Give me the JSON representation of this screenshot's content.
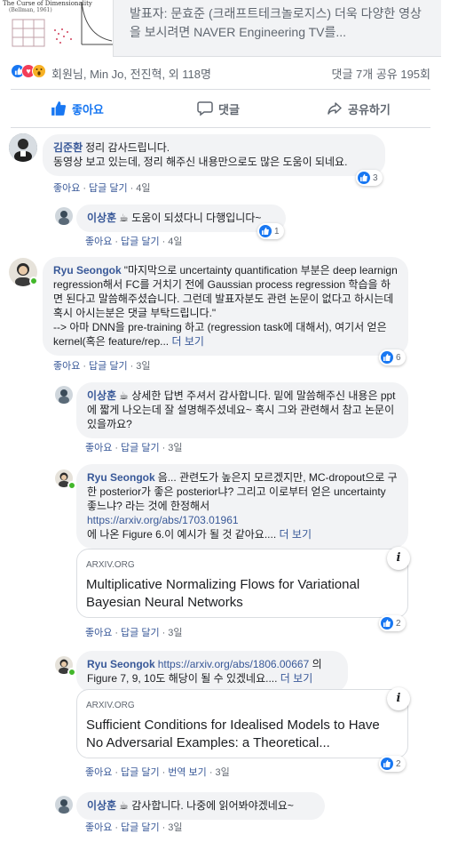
{
  "preview": {
    "thumb_title": "The Curse of Dimensionality",
    "thumb_subtitle": "(Bellman, 1961)",
    "description": "발표자: 문효준 (크래프트테크놀로지스) 더욱 다양한 영상을 보시려면 NAVER Engineering TV를..."
  },
  "summary": {
    "names": "회원님, Min Jo, 전진혁, 외 118명",
    "counts": "댓글 7개  공유 195회"
  },
  "actions": {
    "like": "좋아요",
    "comment": "댓글",
    "share": "공유하기"
  },
  "labels": {
    "like": "좋아요",
    "reply": "답글 달기",
    "translate": "번역 보기",
    "see_more": "더 보기",
    "info": "i"
  },
  "comments": [
    {
      "author": "김준환",
      "text": "정리 감사드립니다.\n동영상 보고 있는데, 정리 해주신 내용만으로도 많은 도움이 되네요.",
      "time": "4일",
      "likes": "3"
    },
    {
      "author": "이상훈",
      "text": "도움이 되셨다니 다행입니다~",
      "time": "4일",
      "likes": "1"
    },
    {
      "author": "Ryu Seongok",
      "text": "\"마지막으로 uncertainty quantification 부분은 deep learnign regression해서 FC를 거치기 전에 Gaussian process regression 학습을 하면 된다고 말씀해주셨습니다. 그런데 발표자분도 관련 논문이 없다고 하시는데 혹시 아시는분은 댓글 부탁드립니다.\"\n--> 아마 DNN을 pre-training 하고 (regression task에 대해서), 여기서 얻은 kernel(혹은 feature/rep...",
      "time": "3일",
      "likes": "6"
    },
    {
      "author": "이상훈",
      "text": "상세한 답변 주셔서 감사합니다. 밑에 말씀해주신 내용은 ppt에 짧게 나오는데 잘 설명해주셨네요~ 혹시 그와 관련해서 참고 논문이 있을까요?",
      "time": "3일"
    },
    {
      "author": "Ryu Seongok",
      "text": "음... 관련도가 높은지 모르겠지만, MC-dropout으로 구한 posterior가 좋은 posterior냐? 그리고 이로부터 얻은 uncertainty 좋느냐? 라는 것에 한정해서",
      "link": "https://arxiv.org/abs/1703.01961",
      "text2": "에 나온 Figure 6.이 예시가 될 것 같아요....",
      "card_source": "ARXIV.ORG",
      "card_title": "Multiplicative Normalizing Flows for Variational Bayesian Neural Networks",
      "time": "3일",
      "likes": "2"
    },
    {
      "author": "Ryu Seongok",
      "link": "https://arxiv.org/abs/1806.00667",
      "text": "의 Figure 7, 9, 10도 해당이 될 수 있겠네요....",
      "card_source": "ARXIV.ORG",
      "card_title": "Sufficient Conditions for Idealised Models to Have No Adversarial Examples: a Theoretical...",
      "time": "3일",
      "likes": "2"
    },
    {
      "author": "이상훈",
      "text": "감사합니다. 나중에 읽어봐야겠네요~",
      "time": "3일"
    }
  ],
  "colors": {
    "link": "#385898",
    "like_blue": "#1877f2",
    "bubble": "#f2f3f5",
    "meta": "#606770",
    "online": "#42b72a"
  }
}
